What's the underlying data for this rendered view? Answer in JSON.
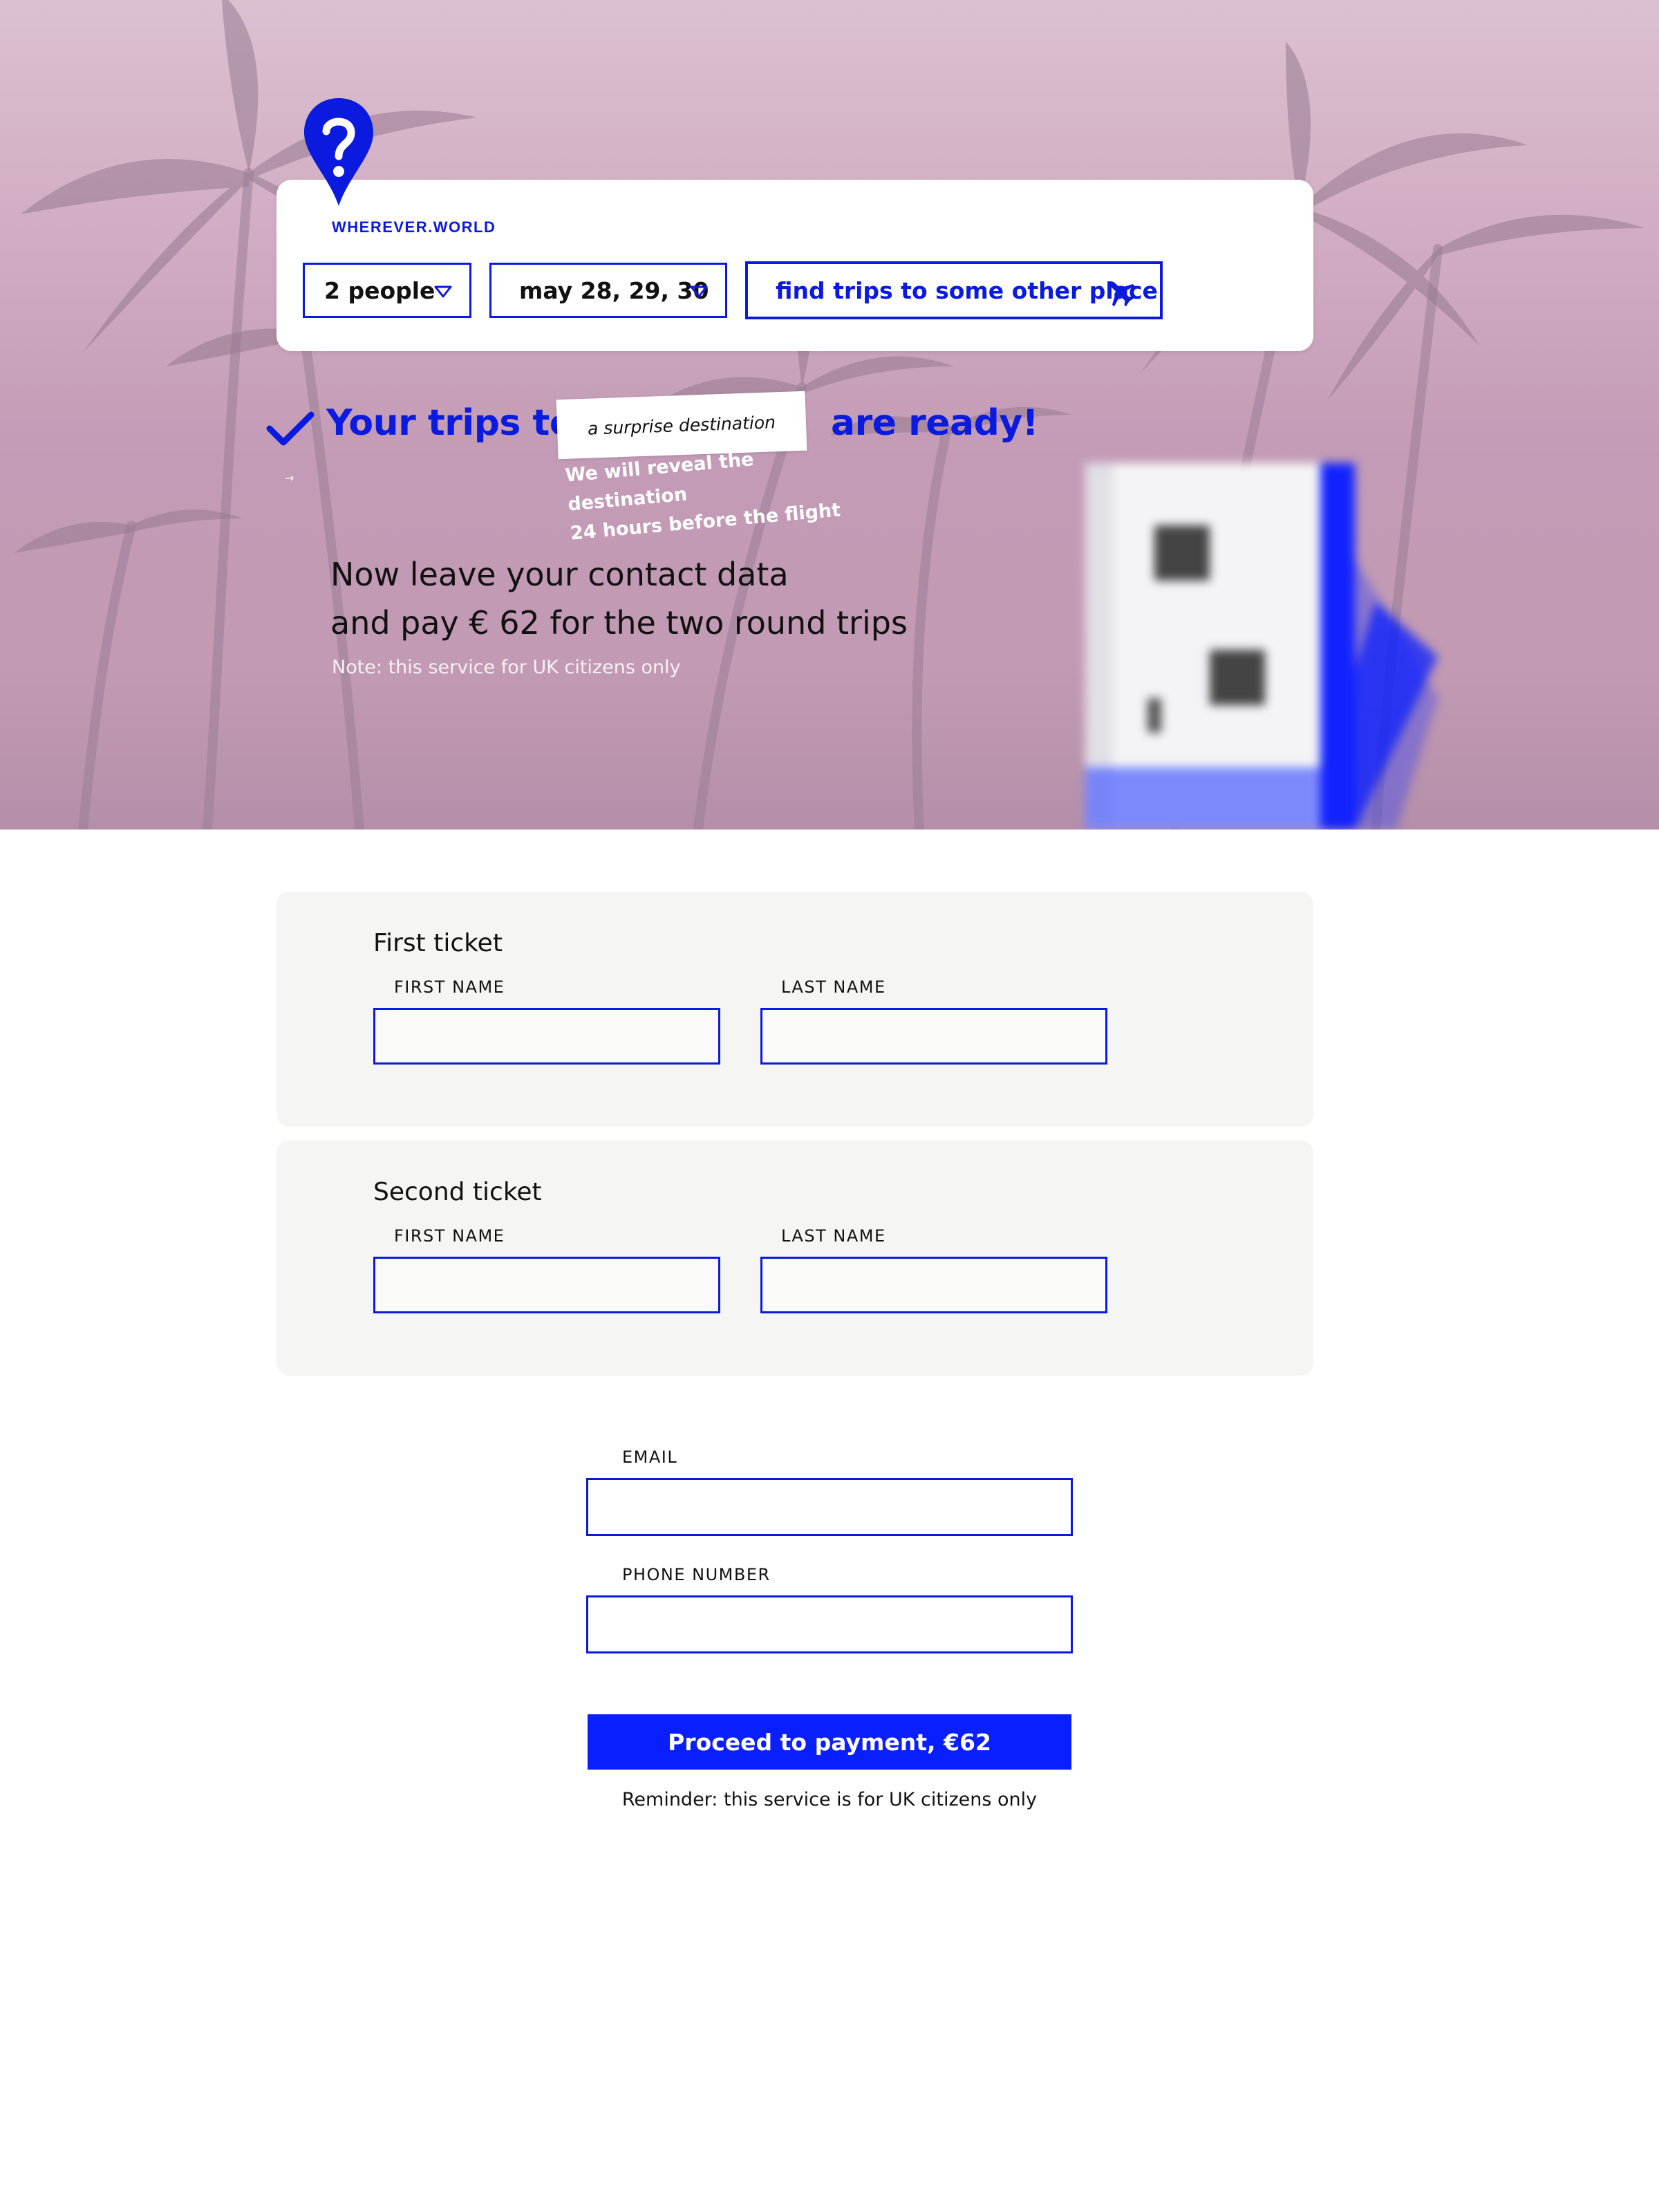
{
  "brand": {
    "name": "WHEREVER.WORLD",
    "logo_icon": "question-pin-icon",
    "accent_color": "#0a1adf"
  },
  "search": {
    "people": "2 people",
    "dates": "may 28, 29, 30",
    "find_label": "find trips to some other place",
    "find_icon": "airplane-icon"
  },
  "hero": {
    "trips_prefix": "Your trips to",
    "destination": "a surprise destination",
    "trips_suffix": "are ready!",
    "reveal_note": "We will reveal the destination\n24 hours  before the flight",
    "contact_lead": "Now leave your contact data\nand pay € 62 for the two round trips",
    "note": "Note: this service for UK citizens only"
  },
  "tickets": [
    {
      "title": "First ticket",
      "first_name_label": "FIRST NAME",
      "last_name_label": "LAST NAME",
      "first_name_value": "",
      "last_name_value": ""
    },
    {
      "title": "Second ticket",
      "first_name_label": "FIRST NAME",
      "last_name_label": "LAST NAME",
      "first_name_value": "",
      "last_name_value": ""
    }
  ],
  "contact": {
    "email_label": "EMAIL",
    "email_value": "",
    "phone_label": "PHONE NUMBER",
    "phone_value": ""
  },
  "payment": {
    "button_label": "Proceed to payment, €62",
    "reminder": "Reminder: this service is for UK citizens only",
    "button_color": "#0a1fff"
  }
}
